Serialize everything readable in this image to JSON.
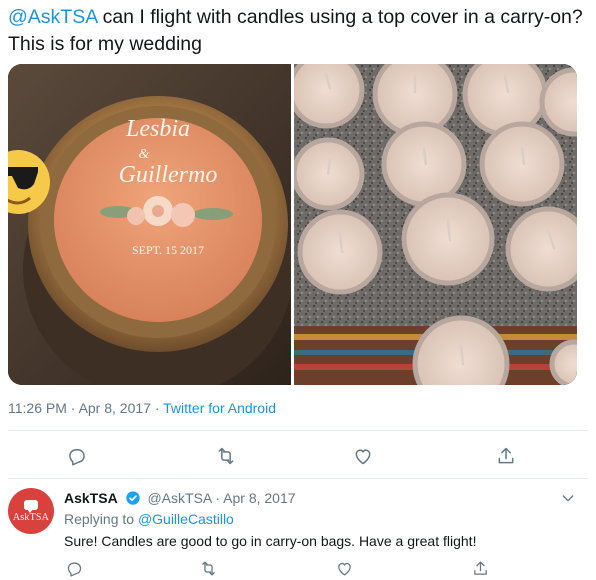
{
  "tweet": {
    "mention": "@AskTSA",
    "text": " can I flight with candles using a top cover in a carry-on? This is for my wedding",
    "time": "11:26 PM",
    "dot1": " · ",
    "date": "Apr 8, 2017",
    "dot2": " · ",
    "source": "Twitter for Android"
  },
  "media": {
    "left": {
      "label_line1": "Lesbia",
      "label_amp": "&",
      "label_line2": "Guillermo",
      "label_date": "SEPT. 15 2017",
      "emoji": "sunglasses-emoji"
    },
    "right": {
      "subject": "candle-jars"
    }
  },
  "actions": {
    "icons": [
      "reply-icon",
      "retweet-icon",
      "like-icon",
      "share-icon"
    ]
  },
  "reply": {
    "avatar_text": "AskTSA",
    "name": "AskTSA",
    "handle": "@AskTSA",
    "dot": " · ",
    "date": "Apr 8, 2017",
    "replying_label": "Replying to ",
    "replying_to": "@GuilleCastillo",
    "body": "Sure! Candles are good to go in carry-on bags. Have a great flight!"
  },
  "colors": {
    "link": "#1b95e0",
    "text": "#14171a",
    "muted": "#657786",
    "divider": "#e6ecf0",
    "verified": "#1da1f2",
    "avatar": "#d9413c"
  }
}
